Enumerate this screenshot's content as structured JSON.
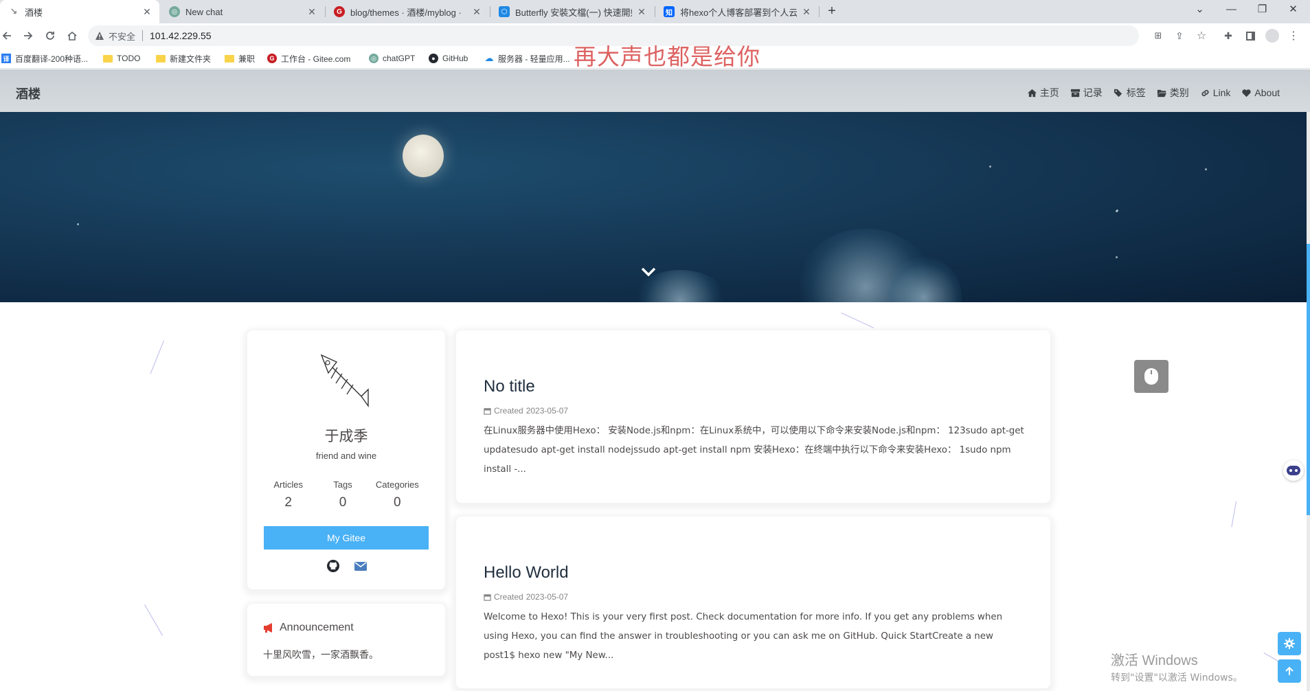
{
  "browser": {
    "tabs": [
      {
        "label": "酒楼",
        "active": true
      },
      {
        "label": "New chat",
        "active": false
      },
      {
        "label": "blog/themes · 酒楼/myblog · ",
        "active": false
      },
      {
        "label": "Butterfly 安裝文檔(一) 快速開始",
        "active": false
      },
      {
        "label": "将hexo个人博客部署到个人云服",
        "active": false
      }
    ],
    "security_label": "不安全",
    "url": "101.42.229.55",
    "bookmarks": [
      {
        "label": "百度翻译-200种语...",
        "icon": "baidu-translate-icon"
      },
      {
        "label": "TODO",
        "icon": "folder-icon"
      },
      {
        "label": "新建文件夹",
        "icon": "folder-icon"
      },
      {
        "label": "兼职",
        "icon": "folder-icon"
      },
      {
        "label": "工作台 - Gitee.com",
        "icon": "gitee-icon"
      },
      {
        "label": "chatGPT",
        "icon": "openai-icon"
      },
      {
        "label": "GitHub",
        "icon": "github-icon"
      },
      {
        "label": "服务器 - 轻量应用...",
        "icon": "cloud-icon"
      }
    ],
    "overlay_text": "再大声也都是给你"
  },
  "blog": {
    "site_title": "酒楼",
    "menu": [
      {
        "label": "主页",
        "icon": "home-icon"
      },
      {
        "label": "记录",
        "icon": "archive-icon"
      },
      {
        "label": "标签",
        "icon": "tags-icon"
      },
      {
        "label": "类别",
        "icon": "folder-open-icon"
      },
      {
        "label": "Link",
        "icon": "link-icon"
      },
      {
        "label": "About",
        "icon": "heart-icon"
      }
    ],
    "author": {
      "name": "于成季",
      "description": "friend and wine",
      "stats": [
        {
          "label": "Articles",
          "value": "2"
        },
        {
          "label": "Tags",
          "value": "0"
        },
        {
          "label": "Categories",
          "value": "0"
        }
      ],
      "button_label": "My Gitee"
    },
    "announcement": {
      "title": "Announcement",
      "text": "十里风吹雪，一家酒飘香。"
    },
    "posts": [
      {
        "title": "No title",
        "created_label": "Created",
        "date": "2023-05-07",
        "excerpt": "在Linux服务器中使用Hexo： 安装Node.js和npm：在Linux系统中，可以使用以下命令来安装Node.js和npm： 123sudo apt-get updatesudo apt-get install nodejssudo apt-get install npm 安装Hexo：在终端中执行以下命令来安装Hexo： 1sudo npm install -..."
      },
      {
        "title": "Hello World",
        "created_label": "Created",
        "date": "2023-05-07",
        "excerpt": "Welcome to Hexo! This is your very first post. Check documentation for more info. If you get any problems when using Hexo, you can find the answer in troubleshooting or you can ask me on GitHub. Quick StartCreate a new post1$ hexo new \"My New..."
      }
    ]
  },
  "watermark": {
    "line1": "激活 Windows",
    "line2": "转到\"设置\"以激活 Windows。"
  },
  "colors": {
    "accent": "#49b1f5",
    "hero_dark": "#0f2a44",
    "announcement_red": "#e43d30"
  }
}
